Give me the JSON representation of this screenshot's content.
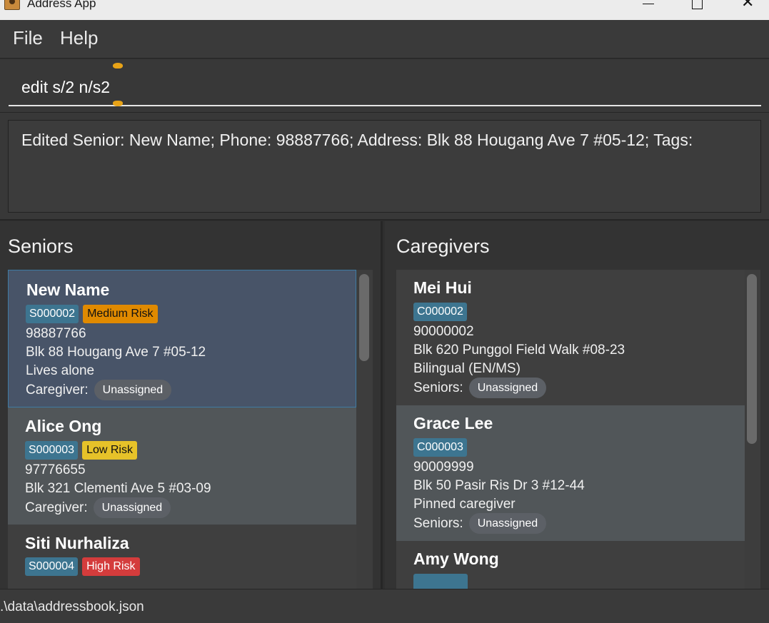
{
  "window": {
    "title": "Address App",
    "minimize_label": "",
    "maximize_label": "",
    "close_symbol": "✕"
  },
  "menu": {
    "file_label": "File",
    "help_label": "Help"
  },
  "command": {
    "value": "edit s/2 n/s2",
    "accent_color": "#e8a317"
  },
  "result": {
    "text": "Edited Senior: New Name; Phone: 98887766; Address: Blk 88 Hougang Ave 7 #05-12; Tags:"
  },
  "seniors": {
    "title": "Seniors",
    "assign_label": "Caregiver:",
    "items": [
      {
        "name": "New Name",
        "id": "S000002",
        "risk": "Medium Risk",
        "risk_color": "#e08a00",
        "phone": "98887766",
        "address": "Blk 88 Hougang Ave 7 #05-12",
        "note": "Lives alone",
        "caregiver": "Unassigned"
      },
      {
        "name": "Alice Ong",
        "id": "S000003",
        "risk": "Low Risk",
        "risk_color": "#e6c229",
        "phone": "97776655",
        "address": "Blk 321 Clementi Ave 5 #03-09",
        "caregiver": "Unassigned"
      },
      {
        "name": "Siti Nurhaliza",
        "id": "S000004",
        "risk": "High Risk",
        "risk_color": "#d43c3c"
      }
    ]
  },
  "caregivers": {
    "title": "Caregivers",
    "assign_label": "Seniors:",
    "items": [
      {
        "name": "Mei Hui",
        "id": "C000002",
        "phone": "90000002",
        "address": "Blk 620 Punggol Field Walk #08-23",
        "note": "Bilingual (EN/MS)",
        "seniors": "Unassigned"
      },
      {
        "name": "Grace Lee",
        "id": "C000003",
        "phone": "90009999",
        "address": "Blk 50 Pasir Ris Dr 3 #12-44",
        "note": "Pinned caregiver",
        "seniors": "Unassigned"
      },
      {
        "name": "Amy Wong"
      }
    ]
  },
  "status": {
    "path": ".\\data\\addressbook.json"
  }
}
